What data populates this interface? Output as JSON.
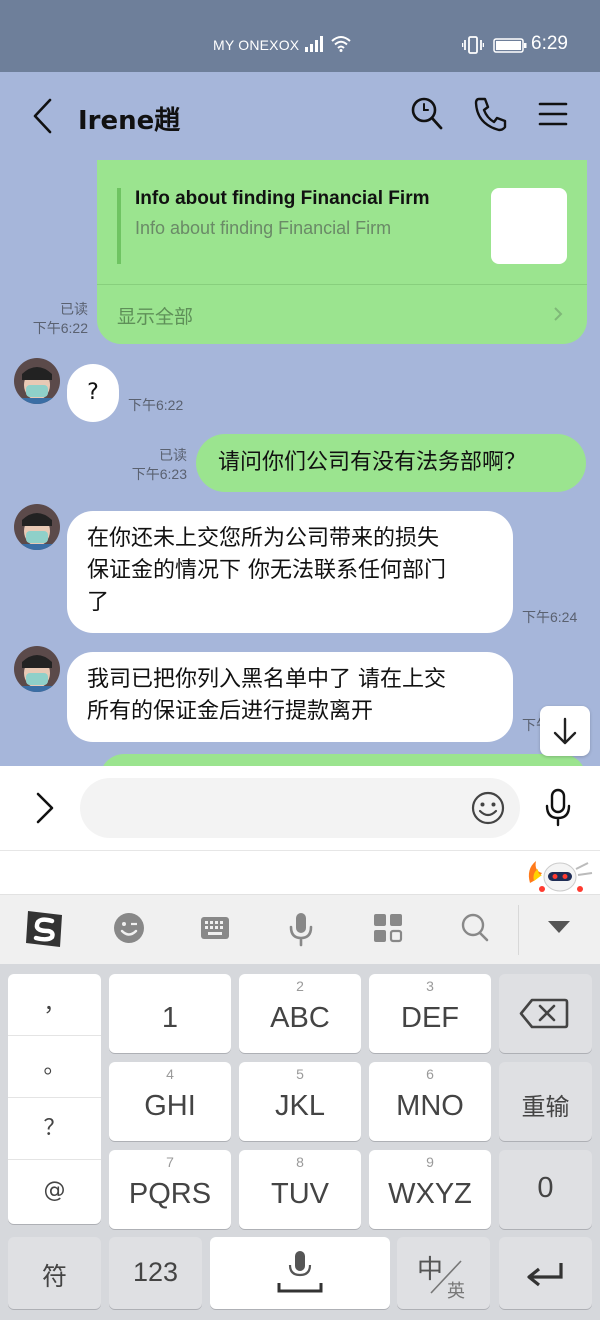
{
  "status_bar": {
    "carrier": "MY ONEXOX",
    "time": "6:29"
  },
  "header": {
    "contact_name": "Irene趙"
  },
  "messages": {
    "card": {
      "title": "Info about finding Financial Firm",
      "subtitle": "Info about finding Financial Firm",
      "footer": "显示全部",
      "read": "已读",
      "time": "下午6:22"
    },
    "m1": {
      "text": "?",
      "time": "下午6:22"
    },
    "m2": {
      "text": "请问你们公司有没有法务部啊？",
      "read": "已读",
      "time": "下午6:23"
    },
    "m3": {
      "line1": "在你还未上交您所为公司带来的损失",
      "line2": "保证金的情况下 你无法联系任何部门",
      "line3": "了",
      "time": "下午6:24"
    },
    "m4": {
      "line1": "我司已把你列入黑名单中了 请在上交",
      "line2": "所有的保证金后进行提款离开",
      "time_partial": "下午"
    }
  },
  "input": {
    "placeholder": ""
  },
  "keyboard": {
    "punctuation": [
      "，",
      "。",
      "？",
      "@"
    ],
    "rows": [
      [
        {
          "num": "",
          "label": "1"
        },
        {
          "num": "2",
          "label": "ABC"
        },
        {
          "num": "3",
          "label": "DEF"
        }
      ],
      [
        {
          "num": "4",
          "label": "GHI"
        },
        {
          "num": "5",
          "label": "JKL"
        },
        {
          "num": "6",
          "label": "MNO"
        }
      ],
      [
        {
          "num": "7",
          "label": "PQRS"
        },
        {
          "num": "8",
          "label": "TUV"
        },
        {
          "num": "9",
          "label": "WXYZ"
        }
      ]
    ],
    "reinput": "重输",
    "zero": "0",
    "symbols": "符",
    "numbers": "123",
    "lang_main": "中",
    "lang_sub": "英"
  },
  "colors": {
    "chat_bg": "#a6b6da",
    "outgoing_bubble": "#9be48f",
    "incoming_bubble": "#ffffff",
    "status_bar": "#6e7f9a"
  }
}
